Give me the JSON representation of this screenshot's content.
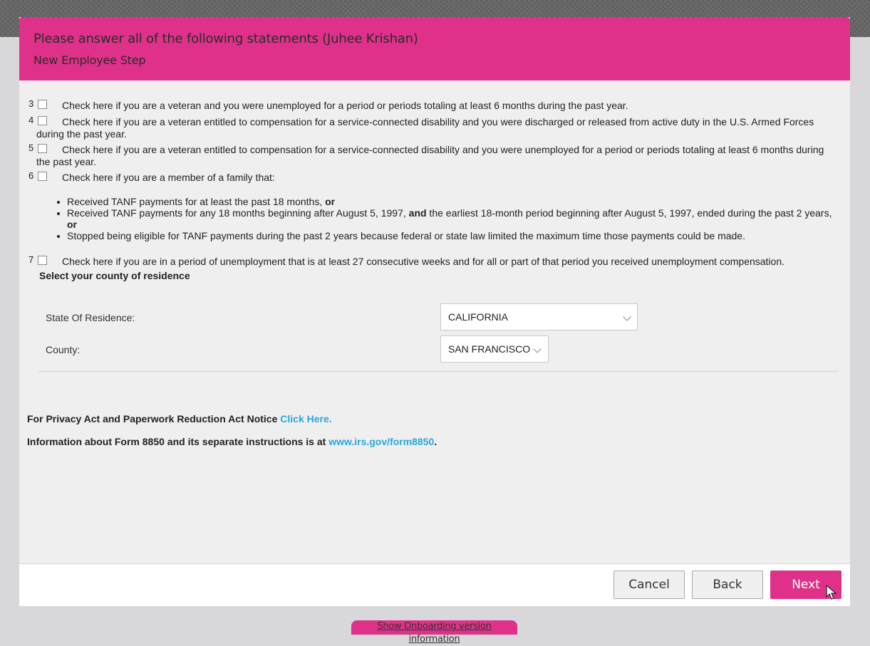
{
  "header": {
    "title": "Please answer all of the following statements (Juhee Krishan)",
    "subtitle": "New Employee Step"
  },
  "statements": [
    {
      "number": "3",
      "text": "Check here if you are a veteran and you were unemployed for a period or periods totaling at least 6 months during the past year.",
      "checked": false
    },
    {
      "number": "4",
      "text": "Check here if you are a veteran entitled to compensation for a service-connected disability and you were discharged or released from active duty in the U.S. Armed Forces during the past year.",
      "checked": false
    },
    {
      "number": "5",
      "text": "Check here if you are a veteran entitled to compensation for a service-connected disability and you were unemployed for a period or periods totaling at least 6 months during the past year.",
      "checked": false
    },
    {
      "number": "6",
      "text": "Check here if you are a member of a family that:",
      "checked": false
    },
    {
      "number": "7",
      "text": "Check here if you are in a period of unemployment that is at least 27 consecutive weeks and for all or part of that period you received unemployment compensation.",
      "checked": false
    }
  ],
  "family_bullets": {
    "b1_text": "Received TANF payments for at least the past 18 months, ",
    "b1_bold": "or",
    "b2_text_a": "Received TANF payments for any 18 months beginning after August 5, 1997, ",
    "b2_bold_a": "and",
    "b2_text_b": " the earliest 18-month period beginning after August 5, 1997, ended during the past 2 years, ",
    "b2_bold_b": "or",
    "b3_text": "Stopped being eligible for TANF payments during the past 2 years because federal or state law limited the maximum time those payments could be made."
  },
  "residence": {
    "heading": "Select your county of residence",
    "state_label": "State Of Residence:",
    "state_value": "CALIFORNIA",
    "county_label": "County:",
    "county_value": "SAN FRANCISCO"
  },
  "notices": {
    "privacy_text": "For Privacy Act and Paperwork Reduction Act Notice ",
    "privacy_link": "Click Here.",
    "form_text": "Information about Form 8850 and its separate instructions is at ",
    "form_link": "www.irs.gov/form8850",
    "form_end": "."
  },
  "footer": {
    "cancel_label": "Cancel",
    "back_label": "Back",
    "next_label": "Next"
  },
  "version_link": "Show Onboarding version information",
  "colors": {
    "accent": "#e0318a",
    "link": "#29a8dc",
    "panel": "#efefef"
  }
}
